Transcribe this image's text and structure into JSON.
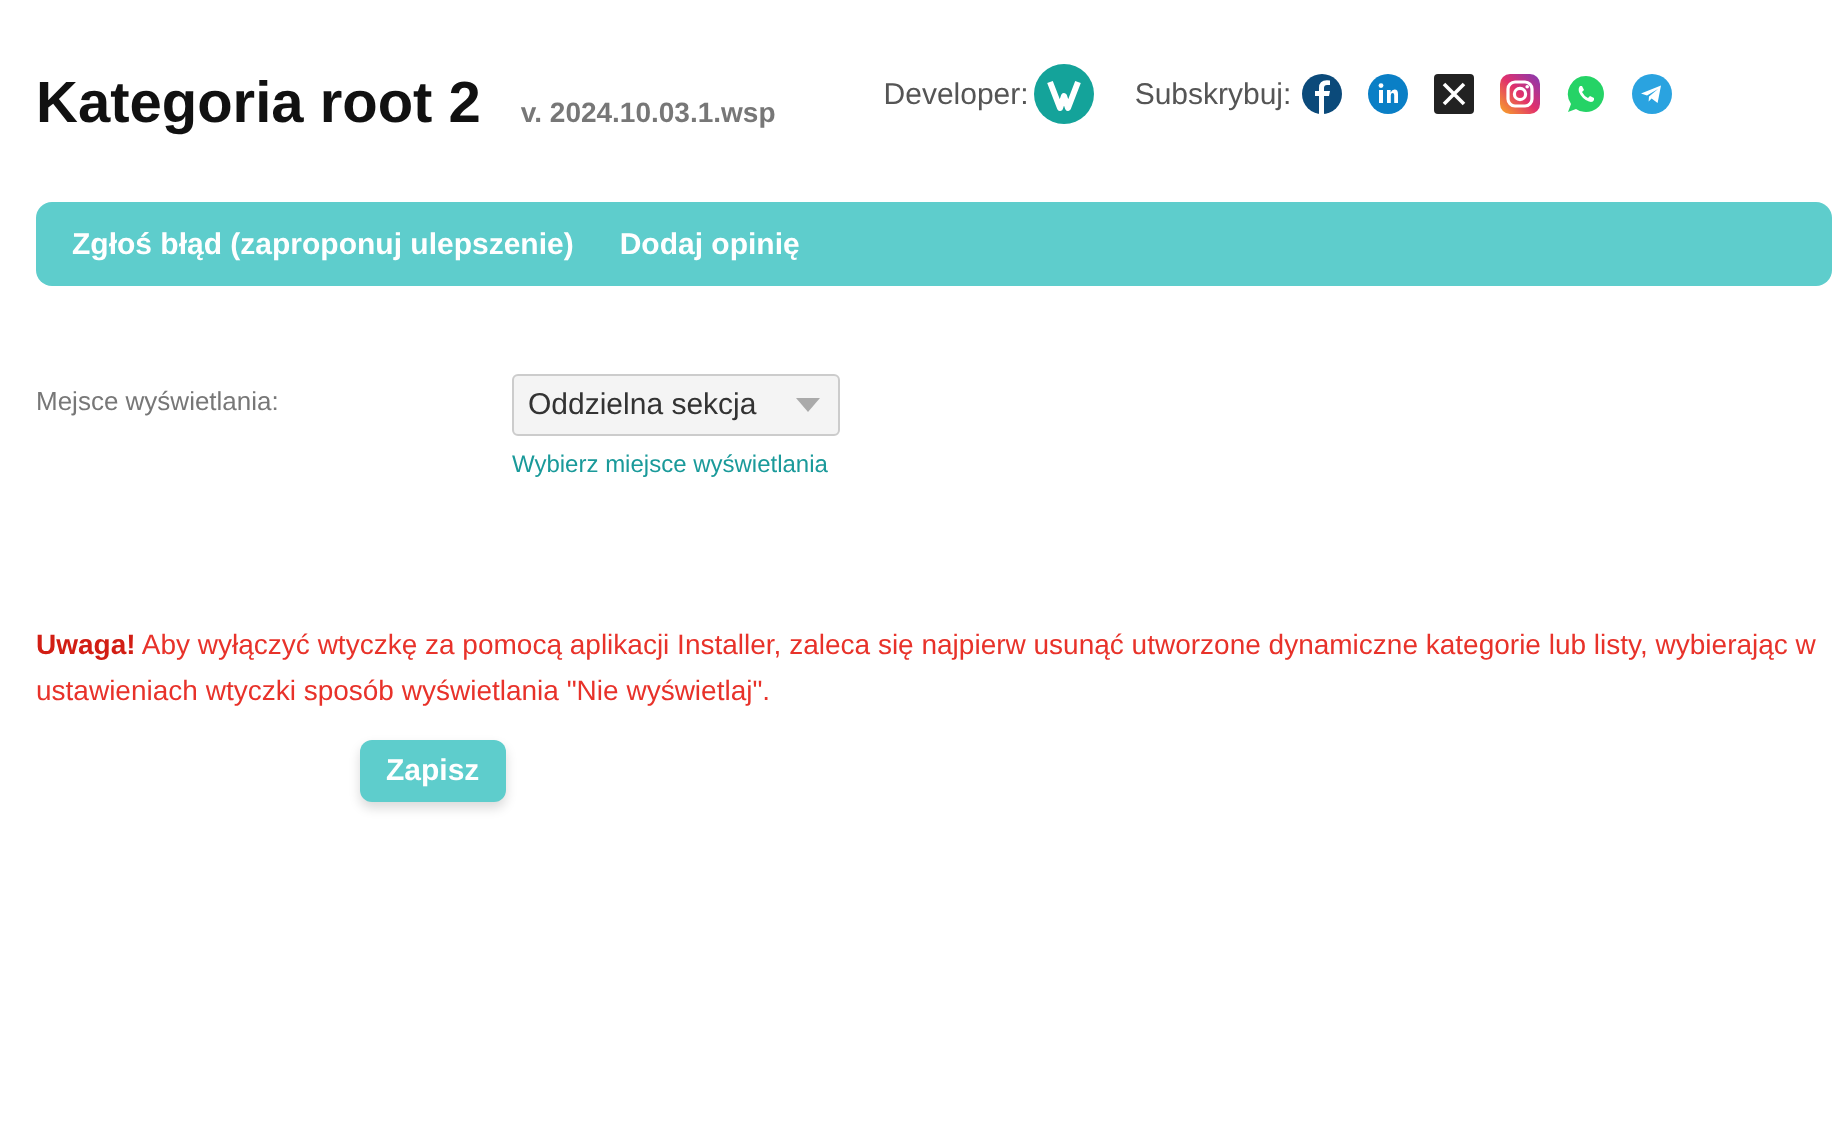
{
  "header": {
    "title": "Kategoria root 2",
    "version": "v. 2024.10.03.1.wsp",
    "developer_label": "Developer:",
    "subscribe_label": "Subskrybuj:"
  },
  "nav": [
    {
      "label": "Zgłoś błąd (zaproponuj ulepszenie)"
    },
    {
      "label": "Dodaj opinię"
    }
  ],
  "form": {
    "label": "Mejsce wyświetlania:",
    "select_value": "Oddzielna sekcja",
    "hint": "Wybierz miejsce wyświetlania"
  },
  "warning": "**Uwaga!** Aby wyłączyć wtyczkę za pomocą aplikacji Installer, zaleca się najpierw usunąć utworzone dynamiczne kategorie lub listy, wybierając w ustawieniach wtyczki sposób wyświetlania \"Nie wyświetlaj\".",
  "save_button": "Zapisz"
}
